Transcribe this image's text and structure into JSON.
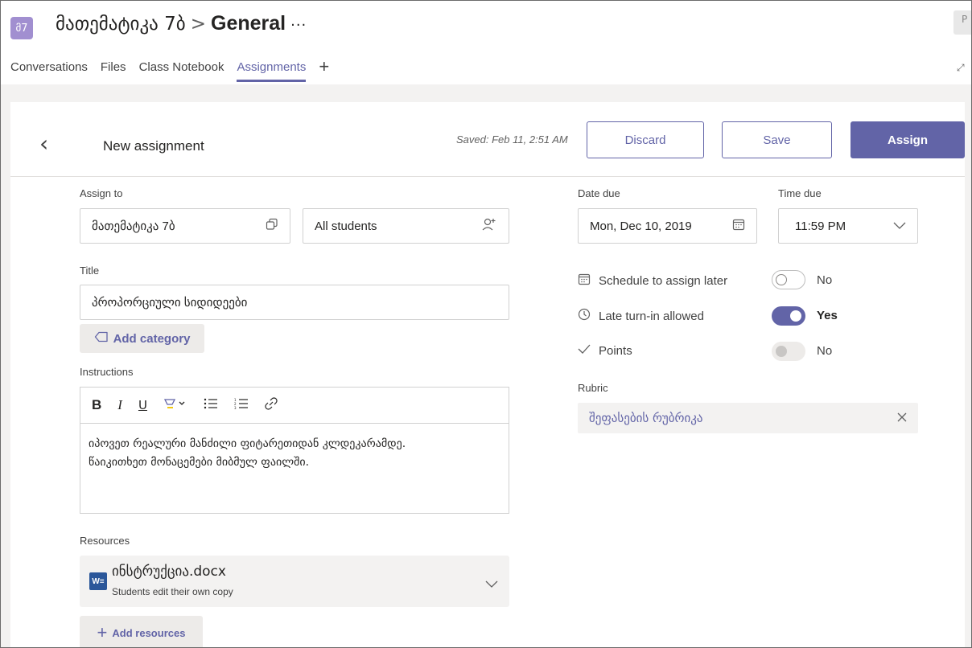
{
  "header": {
    "team_avatar": "მ7",
    "team_name": "მათემატიკა 7ბ",
    "separator": ">",
    "channel": "General",
    "more": "···",
    "right_chip": "P"
  },
  "tabs": [
    {
      "label": "Conversations",
      "active": false
    },
    {
      "label": "Files",
      "active": false
    },
    {
      "label": "Class Notebook",
      "active": false
    },
    {
      "label": "Assignments",
      "active": true
    }
  ],
  "add_tab": "+",
  "toolbar": {
    "back": "‹",
    "title": "New assignment",
    "saved": "Saved: Feb 11, 2:51 AM",
    "discard": "Discard",
    "save": "Save",
    "assign": "Assign"
  },
  "form": {
    "assign_to_label": "Assign to",
    "class_value": "მათემატიკა 7ბ",
    "students_value": "All students",
    "title_label": "Title",
    "title_value": "პროპორციული სიდიდეები",
    "add_category": "Add category",
    "instructions_label": "Instructions",
    "editor_tools": {
      "bold": "B",
      "italic": "I",
      "underline": "U",
      "highlight": "▿",
      "bullets": "☰",
      "numbered": "☷",
      "link": "🔗"
    },
    "instructions_line1": "იპოვეთ რეალური მანძილი ფიტარეთიდან კლდეკარამდე.",
    "instructions_line2": "წაიკითხეთ მონაცემები მიბმულ ფაილში.",
    "resources_label": "Resources",
    "resource_file": "ინსტრუქცია.docx",
    "resource_sub": "Students edit their own copy",
    "add_resources": "Add resources"
  },
  "due": {
    "date_label": "Date due",
    "date_value": "Mon, Dec 10, 2019",
    "time_label": "Time due",
    "time_value": "11:59 PM"
  },
  "options": {
    "schedule_label": "Schedule to assign later",
    "schedule_value": "No",
    "schedule_on": false,
    "late_label": "Late turn-in allowed",
    "late_value": "Yes",
    "late_on": true,
    "points_label": "Points",
    "points_value": "No",
    "points_on": false
  },
  "rubric": {
    "label": "Rubric",
    "value": "შეფასების რუბრიკა"
  },
  "colors": {
    "accent": "#6264a7",
    "avatar": "#a18fd0",
    "word": "#2b579a"
  }
}
